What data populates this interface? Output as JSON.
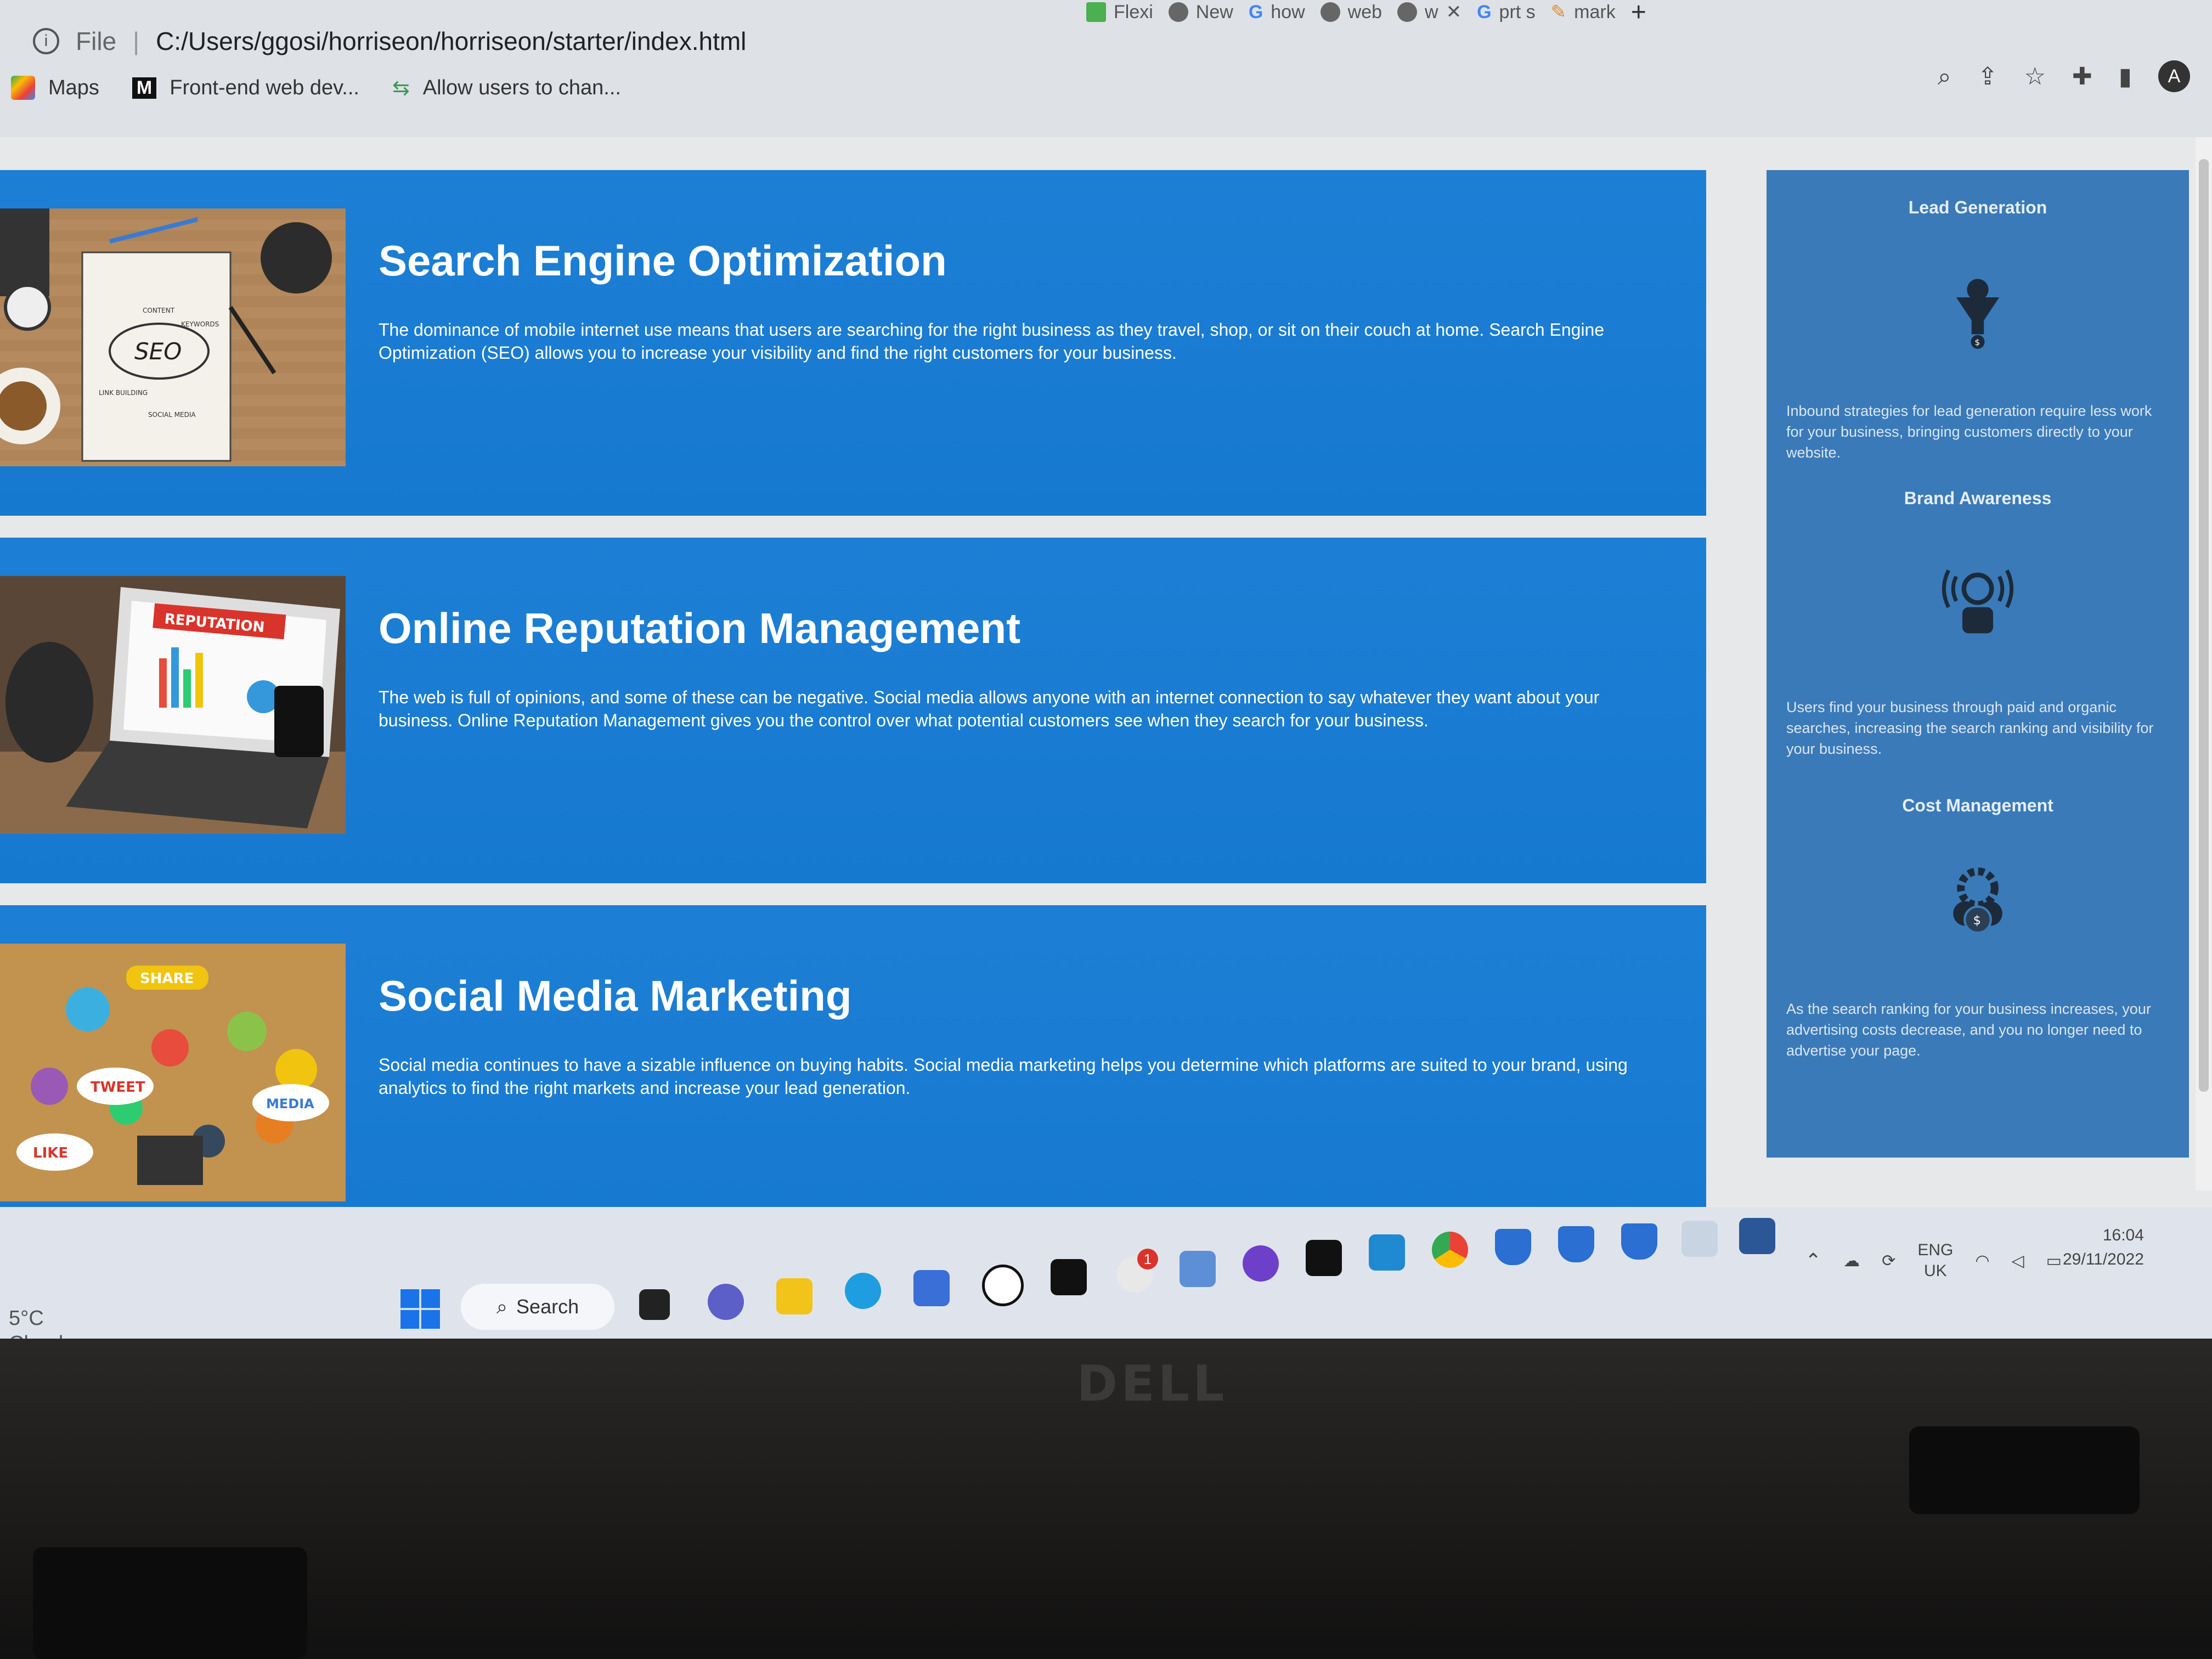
{
  "browser": {
    "tabs": [
      "Flexi",
      "New",
      "how",
      "web",
      "w",
      "prt s",
      "mark"
    ],
    "address": {
      "file_label": "File",
      "url": "C:/Users/ggosi/horriseon/horriseon/starter/index.html"
    },
    "bookmarks": [
      "Maps",
      "Front-end web dev...",
      "Allow users to chan..."
    ],
    "avatar": "A"
  },
  "services": [
    {
      "title": "Search Engine Optimization",
      "text": "The dominance of mobile internet use means that users are searching for the right business as they travel, shop, or sit on their couch at home. Search Engine Optimization (SEO) allows you to increase your visibility and find the right customers for your business.",
      "image_labels": [
        "SEO",
        "CONTENT",
        "KEYWORDS",
        "LINK BUILDING",
        "SOCIAL MEDIA"
      ]
    },
    {
      "title": "Online Reputation Management",
      "text": "The web is full of opinions, and some of these can be negative. Social media allows anyone with an internet connection to say whatever they want about your business. Online Reputation Management gives you the control over what potential customers see when they search for your business.",
      "image_labels": [
        "REPUTATION"
      ]
    },
    {
      "title": "Social Media Marketing",
      "text": "Social media continues to have a sizable influence on buying habits. Social media marketing helps you determine which platforms are suited to your brand, using analytics to find the right markets and increase your lead generation.",
      "image_labels": [
        "SHARE",
        "TWEET",
        "LIKE",
        "MEDIA"
      ]
    }
  ],
  "benefits": [
    {
      "title": "Lead Generation",
      "icon": "funnel-dollar-icon",
      "text": "Inbound strategies for lead generation require less work for your business, bringing customers directly to your website."
    },
    {
      "title": "Brand Awareness",
      "icon": "lightbulb-broadcast-icon",
      "text": "Users find your business through paid and organic searches, increasing the search ranking and visibility for your business."
    },
    {
      "title": "Cost Management",
      "icon": "gear-dollar-icon",
      "text": "As the search ranking for your business increases, your advertising costs decrease, and you no longer need to advertise your page."
    }
  ],
  "taskbar": {
    "weather": {
      "temp": "5°C",
      "condition": "Cloudy"
    },
    "search_label": "Search",
    "slack_badge": "1",
    "lang": {
      "line1": "ENG",
      "line2": "UK"
    },
    "time": "16:04",
    "date": "29/11/2022"
  },
  "device": {
    "brand": "DELL"
  },
  "colors": {
    "service_bg": "#1679d0",
    "sidebar_bg": "#3a7ab8",
    "taskbar_bg": "#dfe4ec"
  }
}
